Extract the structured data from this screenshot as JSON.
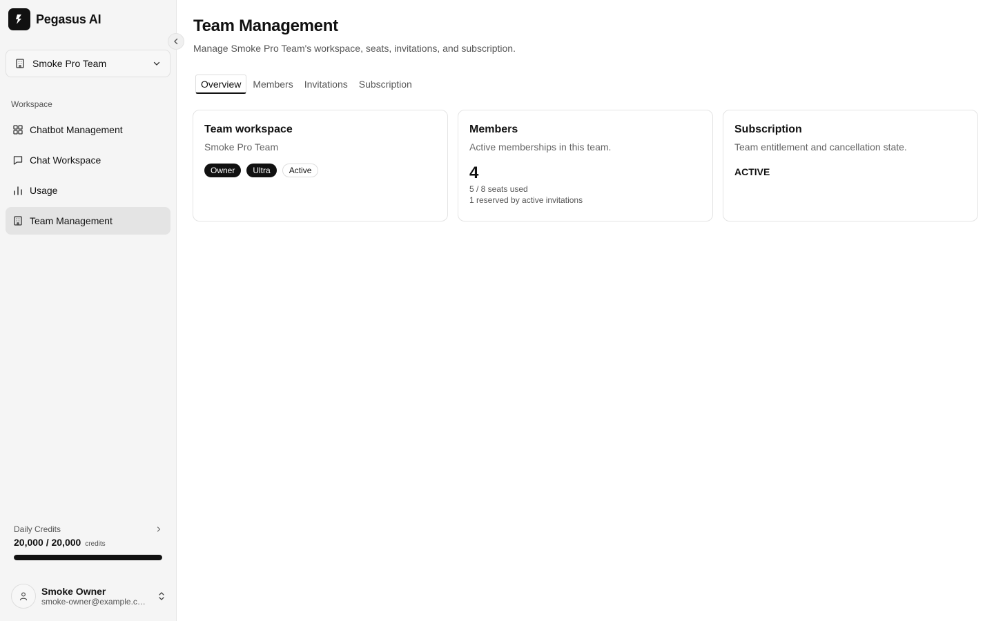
{
  "app": {
    "name": "Pegasus AI"
  },
  "sidebar": {
    "team_select": "Smoke Pro Team",
    "section_label": "Workspace",
    "items": [
      {
        "label": "Chatbot Management",
        "icon": "layout-grid-icon",
        "active": false
      },
      {
        "label": "Chat Workspace",
        "icon": "message-square-icon",
        "active": false
      },
      {
        "label": "Usage",
        "icon": "bar-chart-icon",
        "active": false
      },
      {
        "label": "Team Management",
        "icon": "building-icon",
        "active": true
      }
    ],
    "credits": {
      "label": "Daily Credits",
      "value": "20,000 / 20,000",
      "unit": "credits",
      "fraction": 1.0
    },
    "user": {
      "name": "Smoke Owner",
      "email": "smoke-owner@example.com"
    }
  },
  "main": {
    "title": "Team Management",
    "subtitle": "Manage Smoke Pro Team's workspace, seats, invitations, and subscription.",
    "tabs": [
      {
        "label": "Overview",
        "active": true
      },
      {
        "label": "Members",
        "active": false
      },
      {
        "label": "Invitations",
        "active": false
      },
      {
        "label": "Subscription",
        "active": false
      }
    ],
    "cards": {
      "workspace": {
        "title": "Team workspace",
        "desc": "Smoke Pro Team",
        "badges": [
          "Owner",
          "Ultra",
          "Active"
        ]
      },
      "members": {
        "title": "Members",
        "desc": "Active memberships in this team.",
        "count": "4",
        "seats": "5 / 8 seats used",
        "reserved": "1 reserved by active invitations"
      },
      "subscription": {
        "title": "Subscription",
        "desc": "Team entitlement and cancellation state.",
        "status": "ACTIVE"
      }
    }
  },
  "colors": {
    "accent": "#111111",
    "sidebar_bg": "#f5f5f5",
    "active_item_bg": "#e4e4e4",
    "muted_text": "#555555"
  }
}
